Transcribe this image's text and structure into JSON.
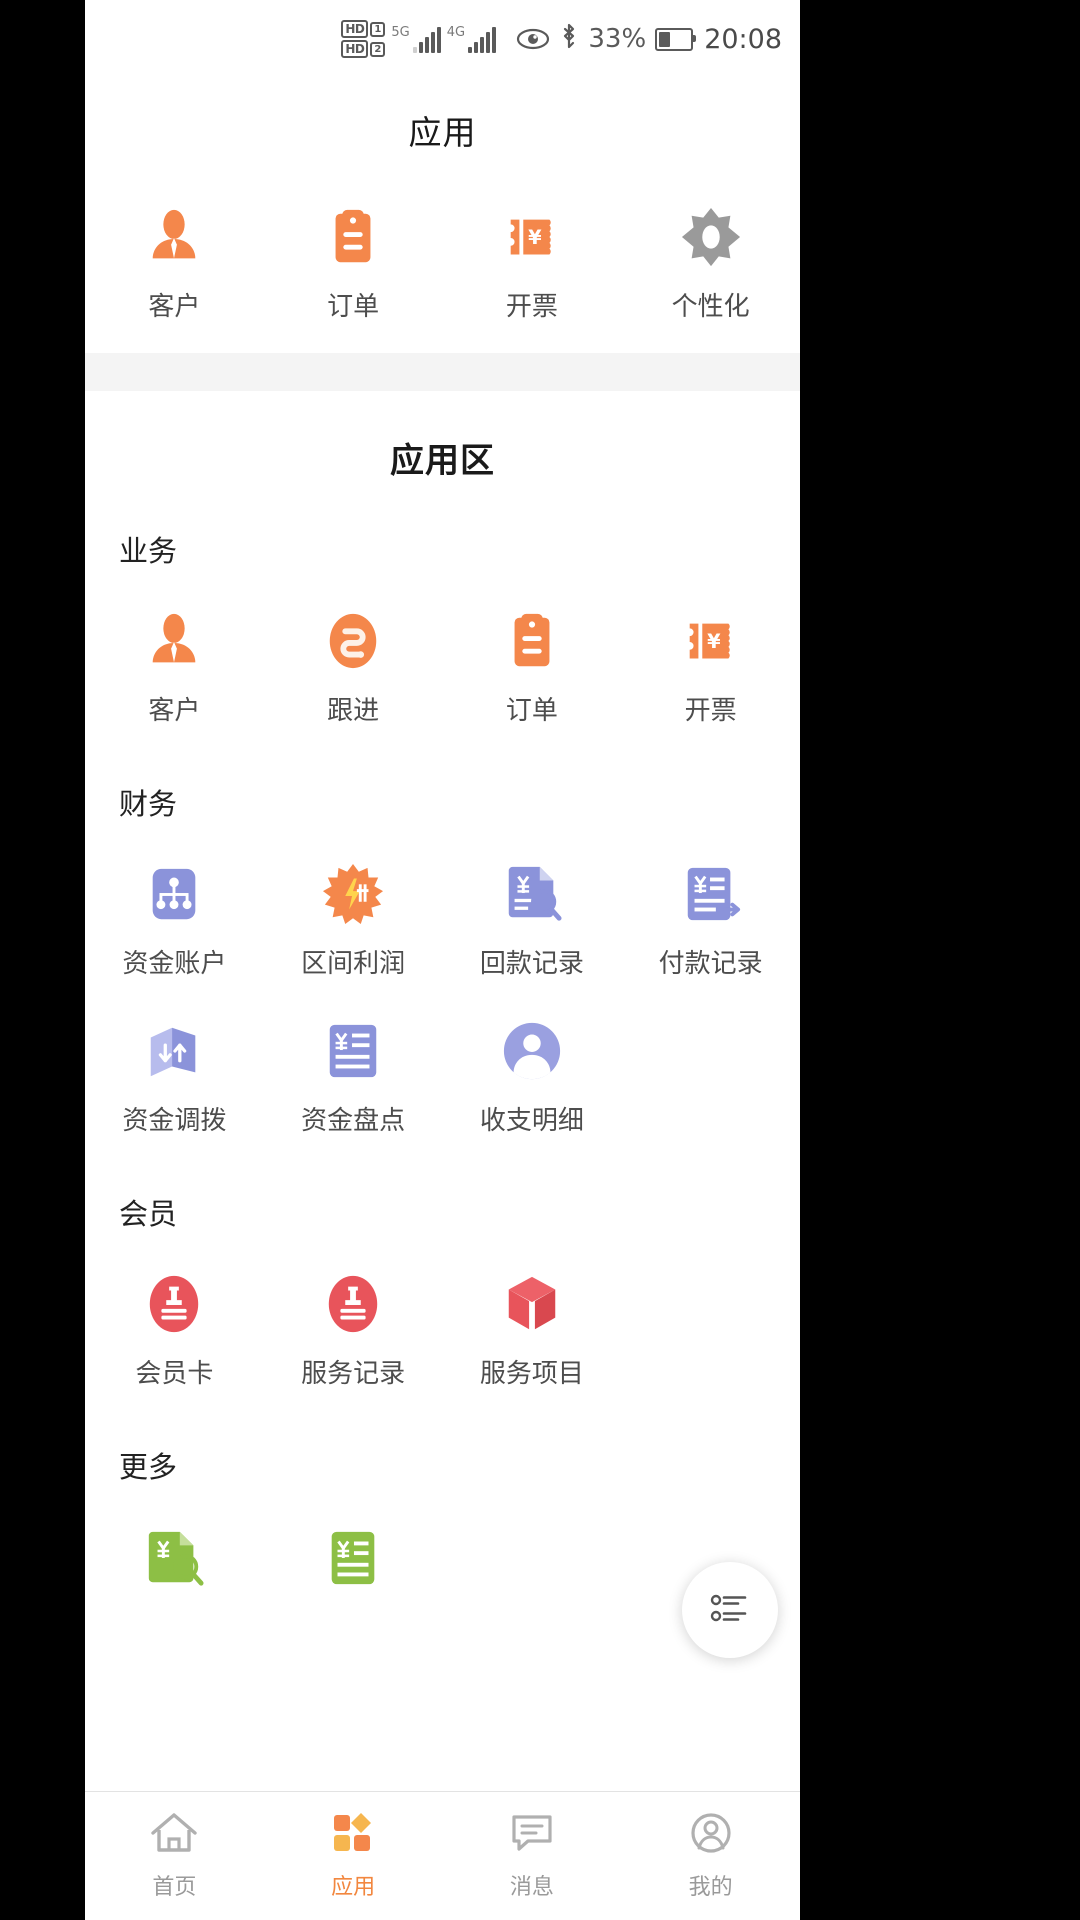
{
  "status_bar": {
    "hd1_label": "HD",
    "hd1_sim": "1",
    "hd2_label": "HD",
    "hd2_sim": "2",
    "network_1": "5G",
    "network_1_sub": "1)",
    "network_2": "4G",
    "eye_icon": "eye-icon",
    "bluetooth_icon": "bluetooth-icon",
    "battery_percent": "33%",
    "battery_level": 33,
    "time": "20:08"
  },
  "header": {
    "title": "应用"
  },
  "favorites": {
    "items": [
      {
        "label": "客户",
        "icon": "customer-icon",
        "color": "#f4874b"
      },
      {
        "label": "订单",
        "icon": "clipboard-icon",
        "color": "#f4874b"
      },
      {
        "label": "开票",
        "icon": "invoice-ticket-icon",
        "color": "#f4874b"
      },
      {
        "label": "个性化",
        "icon": "gear-icon",
        "color": "#9a9a9a"
      }
    ]
  },
  "app_zone": {
    "title": "应用区",
    "groups": [
      {
        "title": "业务",
        "items": [
          {
            "label": "客户",
            "icon": "customer-icon",
            "color": "#f4874b"
          },
          {
            "label": "跟进",
            "icon": "follow-up-icon",
            "color": "#f4874b"
          },
          {
            "label": "订单",
            "icon": "clipboard-icon",
            "color": "#f4874b"
          },
          {
            "label": "开票",
            "icon": "invoice-ticket-icon",
            "color": "#f4874b"
          }
        ]
      },
      {
        "title": "财务",
        "items": [
          {
            "label": "资金账户",
            "icon": "account-tree-icon",
            "color": "#8b93da"
          },
          {
            "label": "区间利润",
            "icon": "profit-burst-icon",
            "color": "#f4874b"
          },
          {
            "label": "回款记录",
            "icon": "payment-received-icon",
            "color": "#8b93da"
          },
          {
            "label": "付款记录",
            "icon": "payment-made-icon",
            "color": "#8b93da"
          },
          {
            "label": "资金调拨",
            "icon": "fund-transfer-icon",
            "color": "#8b93da"
          },
          {
            "label": "资金盘点",
            "icon": "fund-check-icon",
            "color": "#8b93da"
          },
          {
            "label": "收支明细",
            "icon": "income-expense-icon",
            "color": "#8b93da"
          }
        ]
      },
      {
        "title": "会员",
        "items": [
          {
            "label": "会员卡",
            "icon": "member-card-icon",
            "color": "#e8545b"
          },
          {
            "label": "服务记录",
            "icon": "service-record-icon",
            "color": "#e8545b"
          },
          {
            "label": "服务项目",
            "icon": "service-item-box-icon",
            "color": "#e8545b"
          }
        ]
      },
      {
        "title": "更多",
        "items": [
          {
            "label": "",
            "icon": "more-invoice-icon",
            "color": "#8dbf45"
          },
          {
            "label": "",
            "icon": "more-list-icon",
            "color": "#8dbf45"
          }
        ]
      }
    ]
  },
  "fab": {
    "icon": "list-menu-icon"
  },
  "bottom_nav": {
    "items": [
      {
        "label": "首页",
        "icon": "home-icon",
        "active": false
      },
      {
        "label": "应用",
        "icon": "apps-grid-icon",
        "active": true
      },
      {
        "label": "消息",
        "icon": "message-icon",
        "active": false
      },
      {
        "label": "我的",
        "icon": "profile-icon",
        "active": false
      }
    ]
  }
}
